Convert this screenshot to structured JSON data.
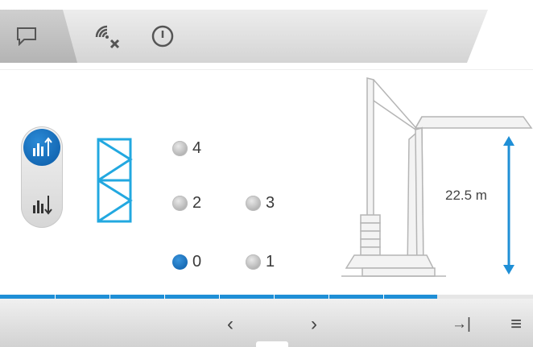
{
  "header": {
    "tabs": [
      {
        "icon": "message-icon",
        "active": true
      },
      {
        "icon": "signal-cancel-icon",
        "active": false
      },
      {
        "icon": "power-icon",
        "active": false
      }
    ]
  },
  "mode_toggle": {
    "options": [
      {
        "icon": "raise-mode-icon",
        "selected": true
      },
      {
        "icon": "lower-mode-icon",
        "selected": false
      }
    ]
  },
  "mast_section_icon": "mast-section-icon",
  "levels": [
    {
      "label": "4",
      "selected": false
    },
    {
      "label": "2",
      "selected": false
    },
    {
      "label": "3",
      "selected": false
    },
    {
      "label": "0",
      "selected": true
    },
    {
      "label": "1",
      "selected": false
    }
  ],
  "crane": {
    "height_label": "22.5 m"
  },
  "progress": {
    "fraction": 0.82,
    "segments": 8
  },
  "footer": {
    "prev_label": "‹",
    "next_label": "›",
    "jump_label": "→|",
    "menu_label": "≡"
  },
  "colors": {
    "accent": "#1f8fd6",
    "selected": "#0b5aa6",
    "outline": "#22a8e0"
  }
}
